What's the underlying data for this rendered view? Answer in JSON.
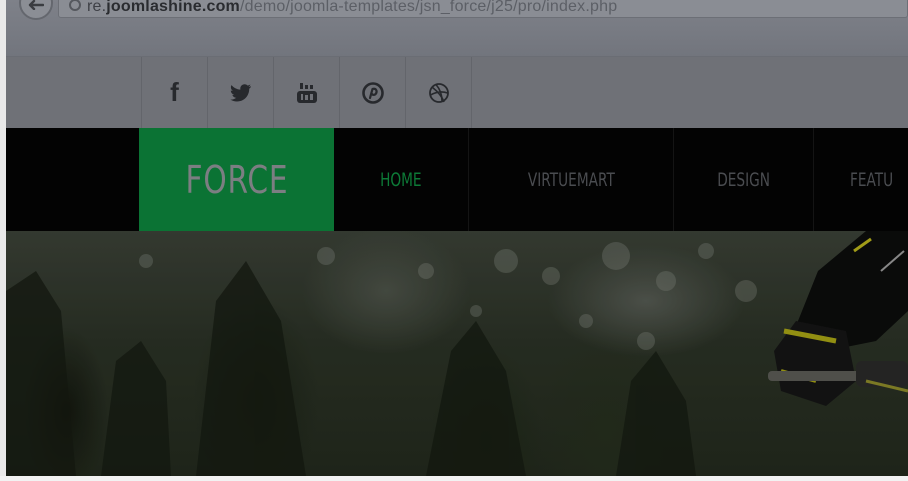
{
  "browser": {
    "url_prefix": "re.",
    "url_host": "joomlashine.com",
    "url_path": "/demo/joomla-templates/jsn_force/j25/pro/index.php"
  },
  "social": {
    "items": [
      {
        "icon": "facebook-icon",
        "glyph": "f"
      },
      {
        "icon": "twitter-icon"
      },
      {
        "icon": "youtube-icon"
      },
      {
        "icon": "pinterest-icon"
      },
      {
        "icon": "dribbble-icon"
      }
    ]
  },
  "navbar": {
    "logo_text": "FORCE",
    "logo_color": "#0b7334",
    "menu": [
      {
        "label": "HOME",
        "active": true
      },
      {
        "label": "VIRTUEMART",
        "active": false
      },
      {
        "label": "DESIGN",
        "active": false
      },
      {
        "label": "FEATU",
        "active": false
      }
    ]
  }
}
